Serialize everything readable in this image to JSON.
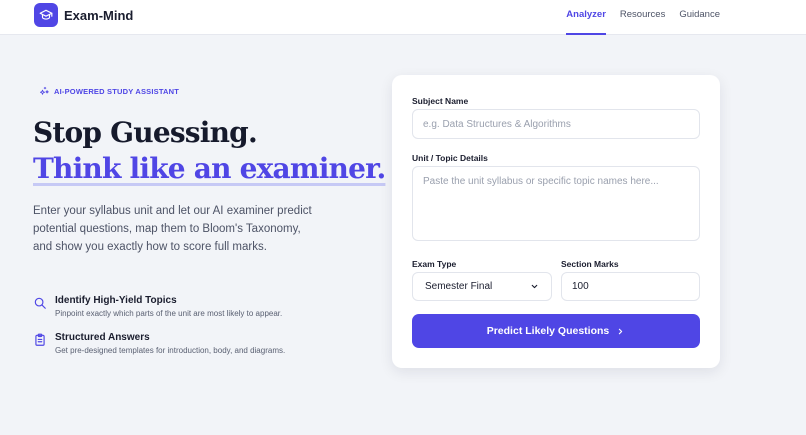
{
  "brand": {
    "name": "Exam-Mind",
    "logo_icon": "graduation-cap-icon",
    "color": "#5046e5"
  },
  "nav": [
    {
      "label": "Analyzer",
      "active": true
    },
    {
      "label": "Resources",
      "active": false
    },
    {
      "label": "Guidance",
      "active": false
    }
  ],
  "hero": {
    "badge": "AI-POWERED STUDY ASSISTANT",
    "badge_icon": "sparkles-icon",
    "headline_line1": "Stop Guessing.",
    "headline_line2": "Think like an examiner.",
    "description": "Enter your syllabus unit and let our AI examiner predict potential questions, map them to Bloom's Taxonomy, and show you exactly how to score full marks."
  },
  "features": [
    {
      "icon": "search-icon",
      "title": "Identify High-Yield Topics",
      "description": "Pinpoint exactly which parts of the unit are most likely to appear."
    },
    {
      "icon": "clipboard-icon",
      "title": "Structured Answers",
      "description": "Get pre-designed templates for introduction, body, and diagrams."
    }
  ],
  "form": {
    "subject_label": "Subject Name",
    "subject_placeholder": "e.g. Data Structures & Algorithms",
    "subject_value": "",
    "topic_label": "Unit / Topic Details",
    "topic_placeholder": "Paste the unit syllabus or specific topic names here...",
    "topic_value": "",
    "exam_type_label": "Exam Type",
    "exam_type_value": "Semester Final",
    "section_marks_label": "Section Marks",
    "section_marks_value": "100",
    "submit_label": "Predict Likely Questions"
  },
  "colors": {
    "accent": "#4f46e5",
    "background": "#f2f4f8",
    "text": "#1a1d2e"
  }
}
